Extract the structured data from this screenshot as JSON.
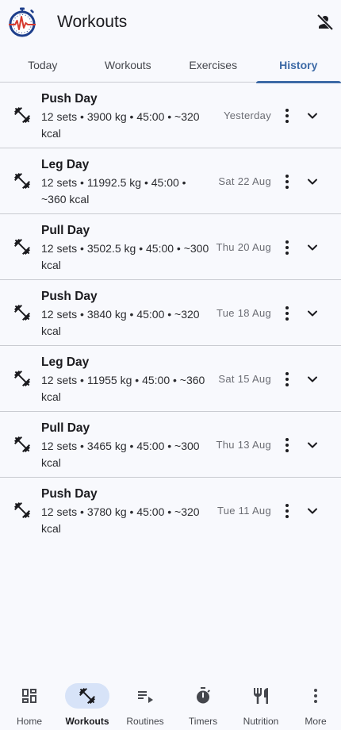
{
  "header": {
    "title": "Workouts",
    "logo_icon": "stopwatch-heartbeat-logo",
    "action_icon": "person-off-icon"
  },
  "tabs": [
    {
      "label": "Today",
      "active": false
    },
    {
      "label": "Workouts",
      "active": false
    },
    {
      "label": "Exercises",
      "active": false
    },
    {
      "label": "History",
      "active": true
    }
  ],
  "history": [
    {
      "title": "Push Day",
      "summary": "12 sets • 3900 kg • 45:00 • ~320 kcal",
      "date": "Yesterday"
    },
    {
      "title": "Leg Day",
      "summary": "12 sets • 11992.5 kg • 45:00 • ~360 kcal",
      "date": "Sat 22 Aug"
    },
    {
      "title": "Pull Day",
      "summary": "12 sets • 3502.5 kg • 45:00 • ~300 kcal",
      "date": "Thu 20 Aug"
    },
    {
      "title": "Push Day",
      "summary": "12 sets • 3840 kg • 45:00 • ~320 kcal",
      "date": "Tue 18 Aug"
    },
    {
      "title": "Leg Day",
      "summary": "12 sets • 11955 kg • 45:00 • ~360 kcal",
      "date": "Sat 15 Aug"
    },
    {
      "title": "Pull Day",
      "summary": "12 sets • 3465 kg • 45:00 • ~300 kcal",
      "date": "Thu 13 Aug"
    },
    {
      "title": "Push Day",
      "summary": "12 sets • 3780 kg • 45:00 • ~320 kcal",
      "date": "Tue 11 Aug"
    }
  ],
  "bottom_nav": [
    {
      "label": "Home",
      "icon": "dashboard-icon",
      "active": false
    },
    {
      "label": "Workouts",
      "icon": "dumbbell-icon",
      "active": true
    },
    {
      "label": "Routines",
      "icon": "playlist-play-icon",
      "active": false
    },
    {
      "label": "Timers",
      "icon": "timer-icon",
      "active": false
    },
    {
      "label": "Nutrition",
      "icon": "restaurant-icon",
      "active": false
    },
    {
      "label": "More",
      "icon": "more-vert-icon",
      "active": false
    }
  ],
  "colors": {
    "accent": "#3d6aa6",
    "active_pill": "#d7e3f8",
    "background": "#f8f9fd",
    "logo_blue": "#1e3f8c",
    "logo_red": "#d63a2f"
  }
}
